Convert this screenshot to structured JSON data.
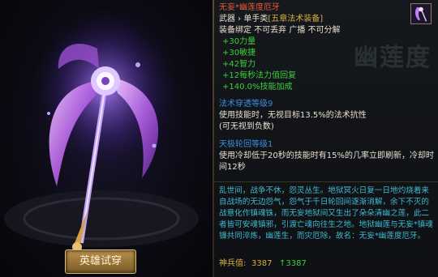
{
  "left": {
    "try_button": "英雄试穿"
  },
  "tooltip": {
    "item_name": "无妄*幽莲度厄牙",
    "type_prefix": "武器 › 单手类",
    "set_name": "[五章法术装备]",
    "bind_info": "装备绑定 不可丢弃 广播 不可分解",
    "watermark": "幽莲度",
    "stats": [
      "+30力量",
      "+30敏捷",
      "+42智力",
      "+12每秒法力值回复",
      "+140.0%技能加成"
    ],
    "skill1": {
      "title": "法术穿透等级9",
      "line1": "使用技能时，无视目标13.5%的法术抗性",
      "line2": "(可无视到负数)"
    },
    "skill2": {
      "title": "天极轮回等级1",
      "line1": "使用冷却低于20秒的技能时有15%的几率立即刷新，冷却时",
      "line2": "间12秒"
    },
    "lore": "乱世间，战争不休，怨灵丛生。地狱冥火日复一日地灼烧着来自战场的无边怨气，怨气于千日轮回间逐渐消解，余下不灭的战意化作镇魂铢，而无妄地狱间又生出了朵朵清幽之莲，此二者皆可安魂镇邪，引渡亡魂向往生之地。地狱幽莲与无妄*镇魂镰共同淬炼，幽莲生，而灾厄除，故名：无妄*幽莲度厄牙。",
    "value_label": "神兵值:",
    "value": "3387",
    "value_up": "↑3387"
  },
  "colors": {
    "name": "#e85a3a",
    "stat": "#3ccf3c",
    "skill_title": "#3a8ee0",
    "lore": "#40b8d0",
    "gold": "#d8b040"
  },
  "icons": {
    "weapon": "scythe-weapon-art",
    "item_icon": "scythe-item-icon"
  }
}
